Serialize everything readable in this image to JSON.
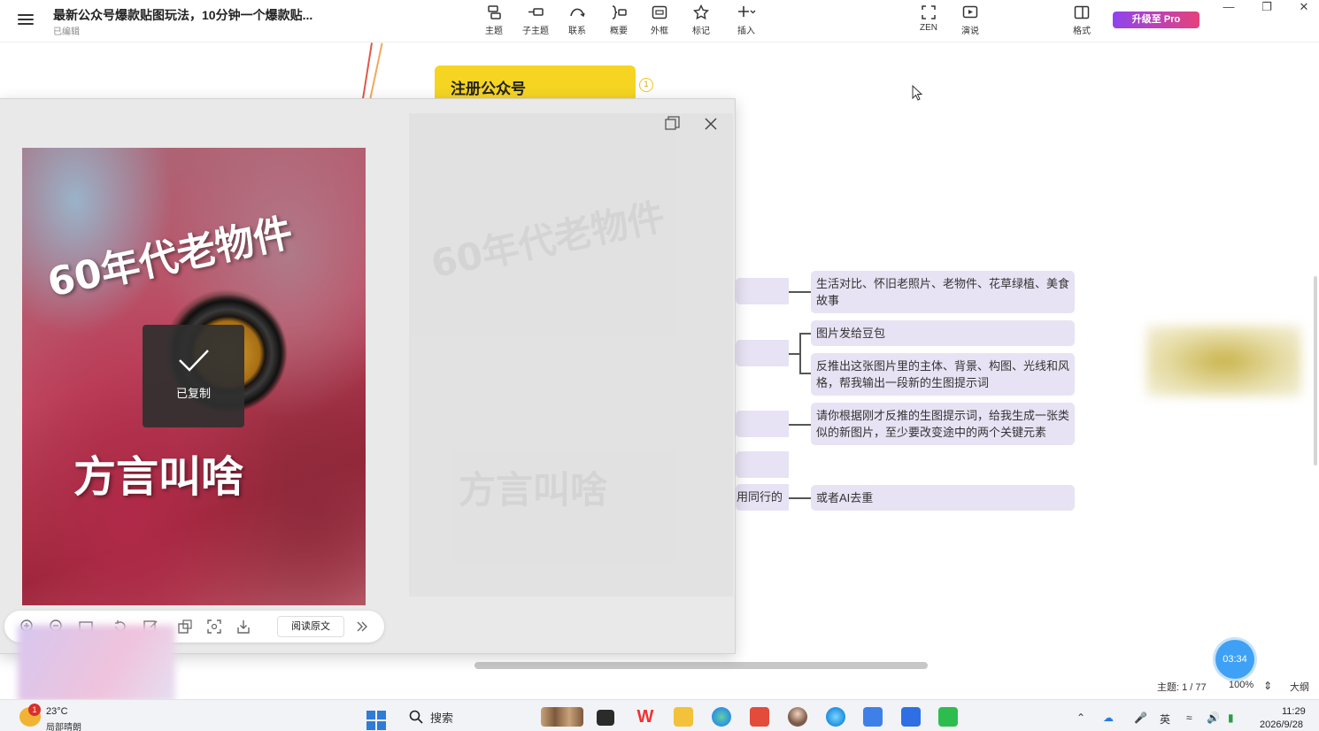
{
  "app": {
    "document_title": "最新公众号爆款贴图玩法，10分钟一个爆款贴...",
    "status": "已编辑",
    "toolbar": [
      {
        "label": "主题",
        "icon": "topic-icon"
      },
      {
        "label": "子主题",
        "icon": "subtopic-icon"
      },
      {
        "label": "联系",
        "icon": "relationship-icon"
      },
      {
        "label": "概要",
        "icon": "summary-icon"
      },
      {
        "label": "外框",
        "icon": "boundary-icon"
      },
      {
        "label": "标记",
        "icon": "marker-star-icon"
      },
      {
        "label": "插入",
        "icon": "insert-plus-icon"
      },
      {
        "label": "ZEN",
        "icon": "zen-fullscreen-icon"
      },
      {
        "label": "演说",
        "icon": "pitch-play-icon"
      },
      {
        "label": "格式",
        "icon": "format-panel-icon"
      }
    ],
    "upgrade_label": "升级至 Pro"
  },
  "mindmap": {
    "root_label": "注册公众号",
    "root_badge": "1",
    "partial_branch_label": "用同行的",
    "nodes": [
      "生活对比、怀旧老照片、老物件、花草绿植、美食故事",
      "图片发给豆包",
      "反推出这张图片里的主体、背景、构图、光线和风格，帮我输出一段新的生图提示词",
      "请你根据刚才反推的生图提示词，给我生成一张类似的新图片，至少要改变途中的两个关键元素",
      "或者AI去重"
    ]
  },
  "viewer": {
    "photo_title": "60年代老物件",
    "photo_subtitle": "方言叫啥",
    "copied_toast": "已复制",
    "read_original": "阅读原文"
  },
  "status_bar": {
    "topic_count": "主题: 1 / 77",
    "zoom": "100%",
    "outline": "大纲",
    "timer": "03:34"
  },
  "taskbar": {
    "weather_temp": "23°C",
    "weather_desc": "局部晴朗",
    "weather_badge": "1",
    "search_placeholder": "搜索",
    "ime_label": "英",
    "clock_time": "11:29",
    "clock_date": "2026/9/28"
  },
  "colors": {
    "root_node": "#f5d522",
    "mm_node": "#e7e3f4",
    "branch_line": "#e0574a",
    "upgrade_gradient_start": "#8e44ef",
    "upgrade_gradient_end": "#e6417a",
    "timer": "#3ea1f5"
  }
}
